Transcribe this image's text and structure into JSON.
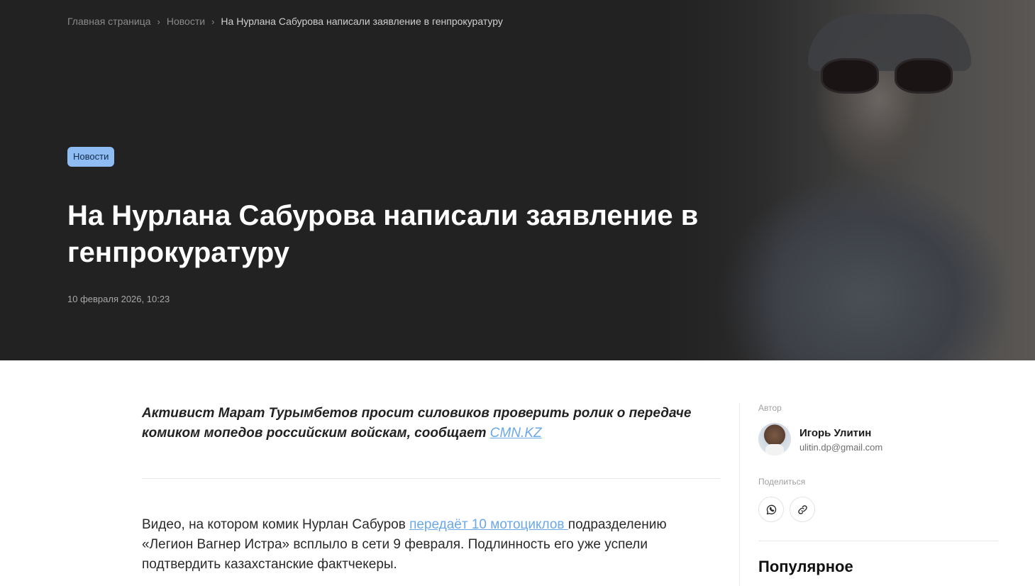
{
  "breadcrumb": {
    "home": "Главная страница",
    "section": "Новости",
    "current": "На Нурлана Сабурова написали заявление в генпрокуратуру"
  },
  "article": {
    "tag": "Новости",
    "title": "На Нурлана Сабурова написали заявление в генпрокуратуру",
    "date": "10 февраля 2026, 10:23",
    "lead_text": "Активист Марат Турымбетов просит силовиков проверить ролик о передаче комиком мопедов российским войскам, сообщает ",
    "lead_link": "CMN.KZ",
    "body_before": "Видео, на котором комик Нурлан Сабуров ",
    "body_link": "передаёт 10 мотоциклов ",
    "body_after": "подразделению «Легион Вагнер Истра» всплыло в сети 9 февраля. Подлинность его уже успели подтвердить казахстанские фактчекеры."
  },
  "sidebar": {
    "author_label": "Автор",
    "author_name": "Игорь Улитин",
    "author_email": "ulitin.dp@gmail.com",
    "share_label": "Поделиться",
    "share_icons": [
      "whatsapp-icon",
      "link-icon"
    ],
    "popular_title": "Популярное"
  },
  "colors": {
    "hero_bg": "#222222",
    "tag_bg": "#8fbdf3",
    "link": "#6aa8e8"
  }
}
